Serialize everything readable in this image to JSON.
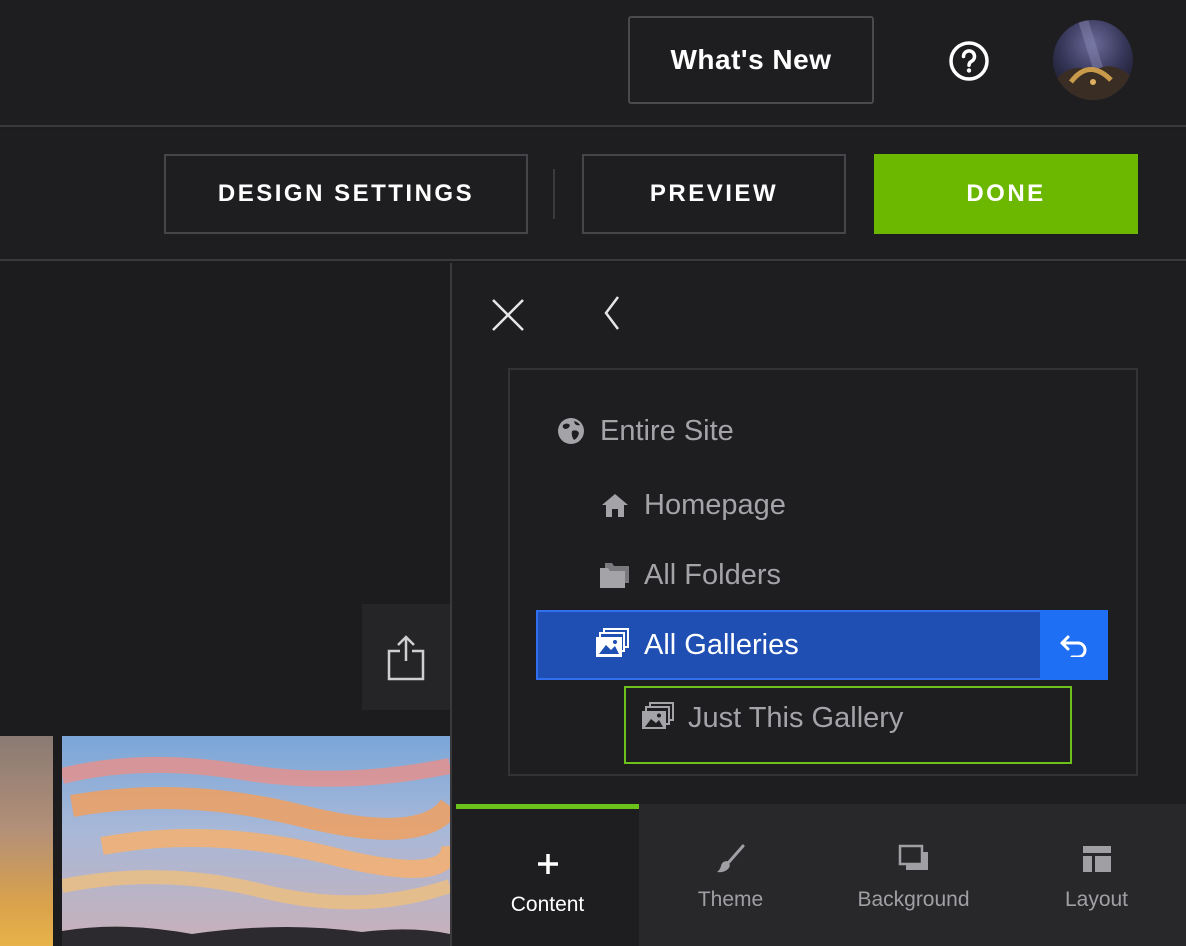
{
  "topbar": {
    "whats_new_label": "What's New"
  },
  "editor_bar": {
    "design_settings_label": "DESIGN SETTINGS",
    "preview_label": "PREVIEW",
    "done_label": "DONE",
    "done_color": "#6cb800"
  },
  "scope_menu": {
    "items": [
      {
        "label": "Entire Site",
        "icon": "globe-icon"
      },
      {
        "label": "Homepage",
        "icon": "home-icon"
      },
      {
        "label": "All Folders",
        "icon": "folders-icon"
      },
      {
        "label": "All Galleries",
        "icon": "galleries-icon",
        "selected": true
      },
      {
        "label": "Just This Gallery",
        "icon": "gallery-icon"
      }
    ],
    "selected_color": "#1f4fb3",
    "highlight_border_color": "#6cc21a"
  },
  "tabs": [
    {
      "label": "Content",
      "icon": "plus-icon",
      "active": true
    },
    {
      "label": "Theme",
      "icon": "brush-icon"
    },
    {
      "label": "Background",
      "icon": "background-icon"
    },
    {
      "label": "Layout",
      "icon": "layout-icon"
    }
  ]
}
